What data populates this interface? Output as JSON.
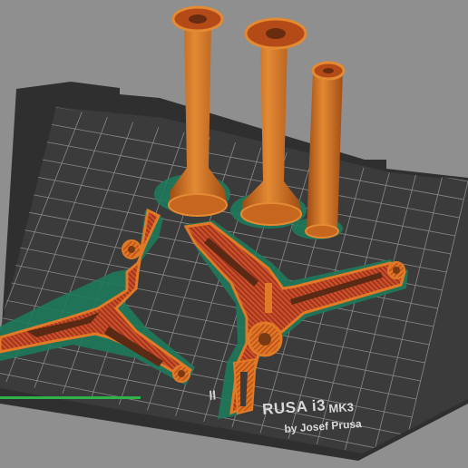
{
  "bed": {
    "name": "RUSA i3",
    "model": "MK3",
    "byline": "by Josef Prusa",
    "partial_text": "ll"
  },
  "colors": {
    "background": "#8f8f8f",
    "bed_plate": "#3b3b3b",
    "bed_frame": "#2a2a2a",
    "grid_line": "#8a8a8a",
    "perimeter": "#d4681a",
    "infill": "#b8352a",
    "skirt_brim": "#1f7a5c",
    "progress": "#2db34a"
  },
  "objects": [
    {
      "name": "spool-holder-tube-1",
      "type": "tube"
    },
    {
      "name": "spool-holder-tube-2",
      "type": "tube"
    },
    {
      "name": "spool-holder-tube-3",
      "type": "tube"
    },
    {
      "name": "tripod-base-left",
      "type": "tripod"
    },
    {
      "name": "tripod-base-right",
      "type": "tripod"
    }
  ],
  "progress": {
    "fraction": 0.3
  }
}
